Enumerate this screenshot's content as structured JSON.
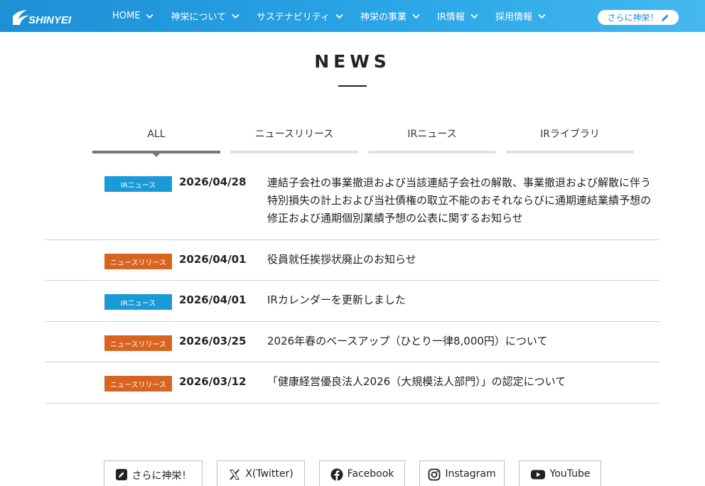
{
  "header": {
    "logo_text": "SHINYEI",
    "nav": [
      {
        "label": "HOME"
      },
      {
        "label": "神栄について"
      },
      {
        "label": "サステナビリティ"
      },
      {
        "label": "神栄の事業"
      },
      {
        "label": "IR情報"
      },
      {
        "label": "採用情報"
      }
    ],
    "cta_label": "さらに神栄！"
  },
  "page": {
    "title": "NEWS"
  },
  "tabs": [
    {
      "label": "ALL",
      "active": true
    },
    {
      "label": "ニュースリリース",
      "active": false
    },
    {
      "label": "IRニュース",
      "active": false
    },
    {
      "label": "IRライブラリ",
      "active": false
    }
  ],
  "news": [
    {
      "category": "IRニュース",
      "date": "2026/04/28",
      "title": "連結子会社の事業撤退および当該連結子会社の解散、事業撤退および解散に伴う特別損失の計上および当社債権の取立不能のおそれならびに通期連結業績予想の修正および通期個別業績予想の公表に関するお知らせ"
    },
    {
      "category": "ニュースリリース",
      "date": "2026/04/01",
      "title": "役員就任挨拶状廃止のお知らせ"
    },
    {
      "category": "IRニュース",
      "date": "2026/04/01",
      "title": "IRカレンダーを更新しました"
    },
    {
      "category": "ニュースリリース",
      "date": "2026/03/25",
      "title": "2026年春のベースアップ（ひとり一律8,000円）について"
    },
    {
      "category": "ニュースリリース",
      "date": "2026/03/12",
      "title": "「健康経営優良法人2026（大規模法人部門）」の認定について"
    }
  ],
  "footer_links": [
    {
      "label": "さらに神栄！",
      "icon": "pencil-square-icon"
    },
    {
      "label": "X(Twitter)",
      "icon": "x-icon"
    },
    {
      "label": "Facebook",
      "icon": "facebook-icon"
    },
    {
      "label": "Instagram",
      "icon": "instagram-icon"
    },
    {
      "label": "YouTube",
      "icon": "youtube-icon"
    }
  ],
  "colors": {
    "header_blue": "#1d8fd6",
    "badge_ir": "#1b9ad8",
    "badge_release": "#d9641f",
    "tab_active": "#777777",
    "tab_inactive": "#e3e3e3"
  }
}
